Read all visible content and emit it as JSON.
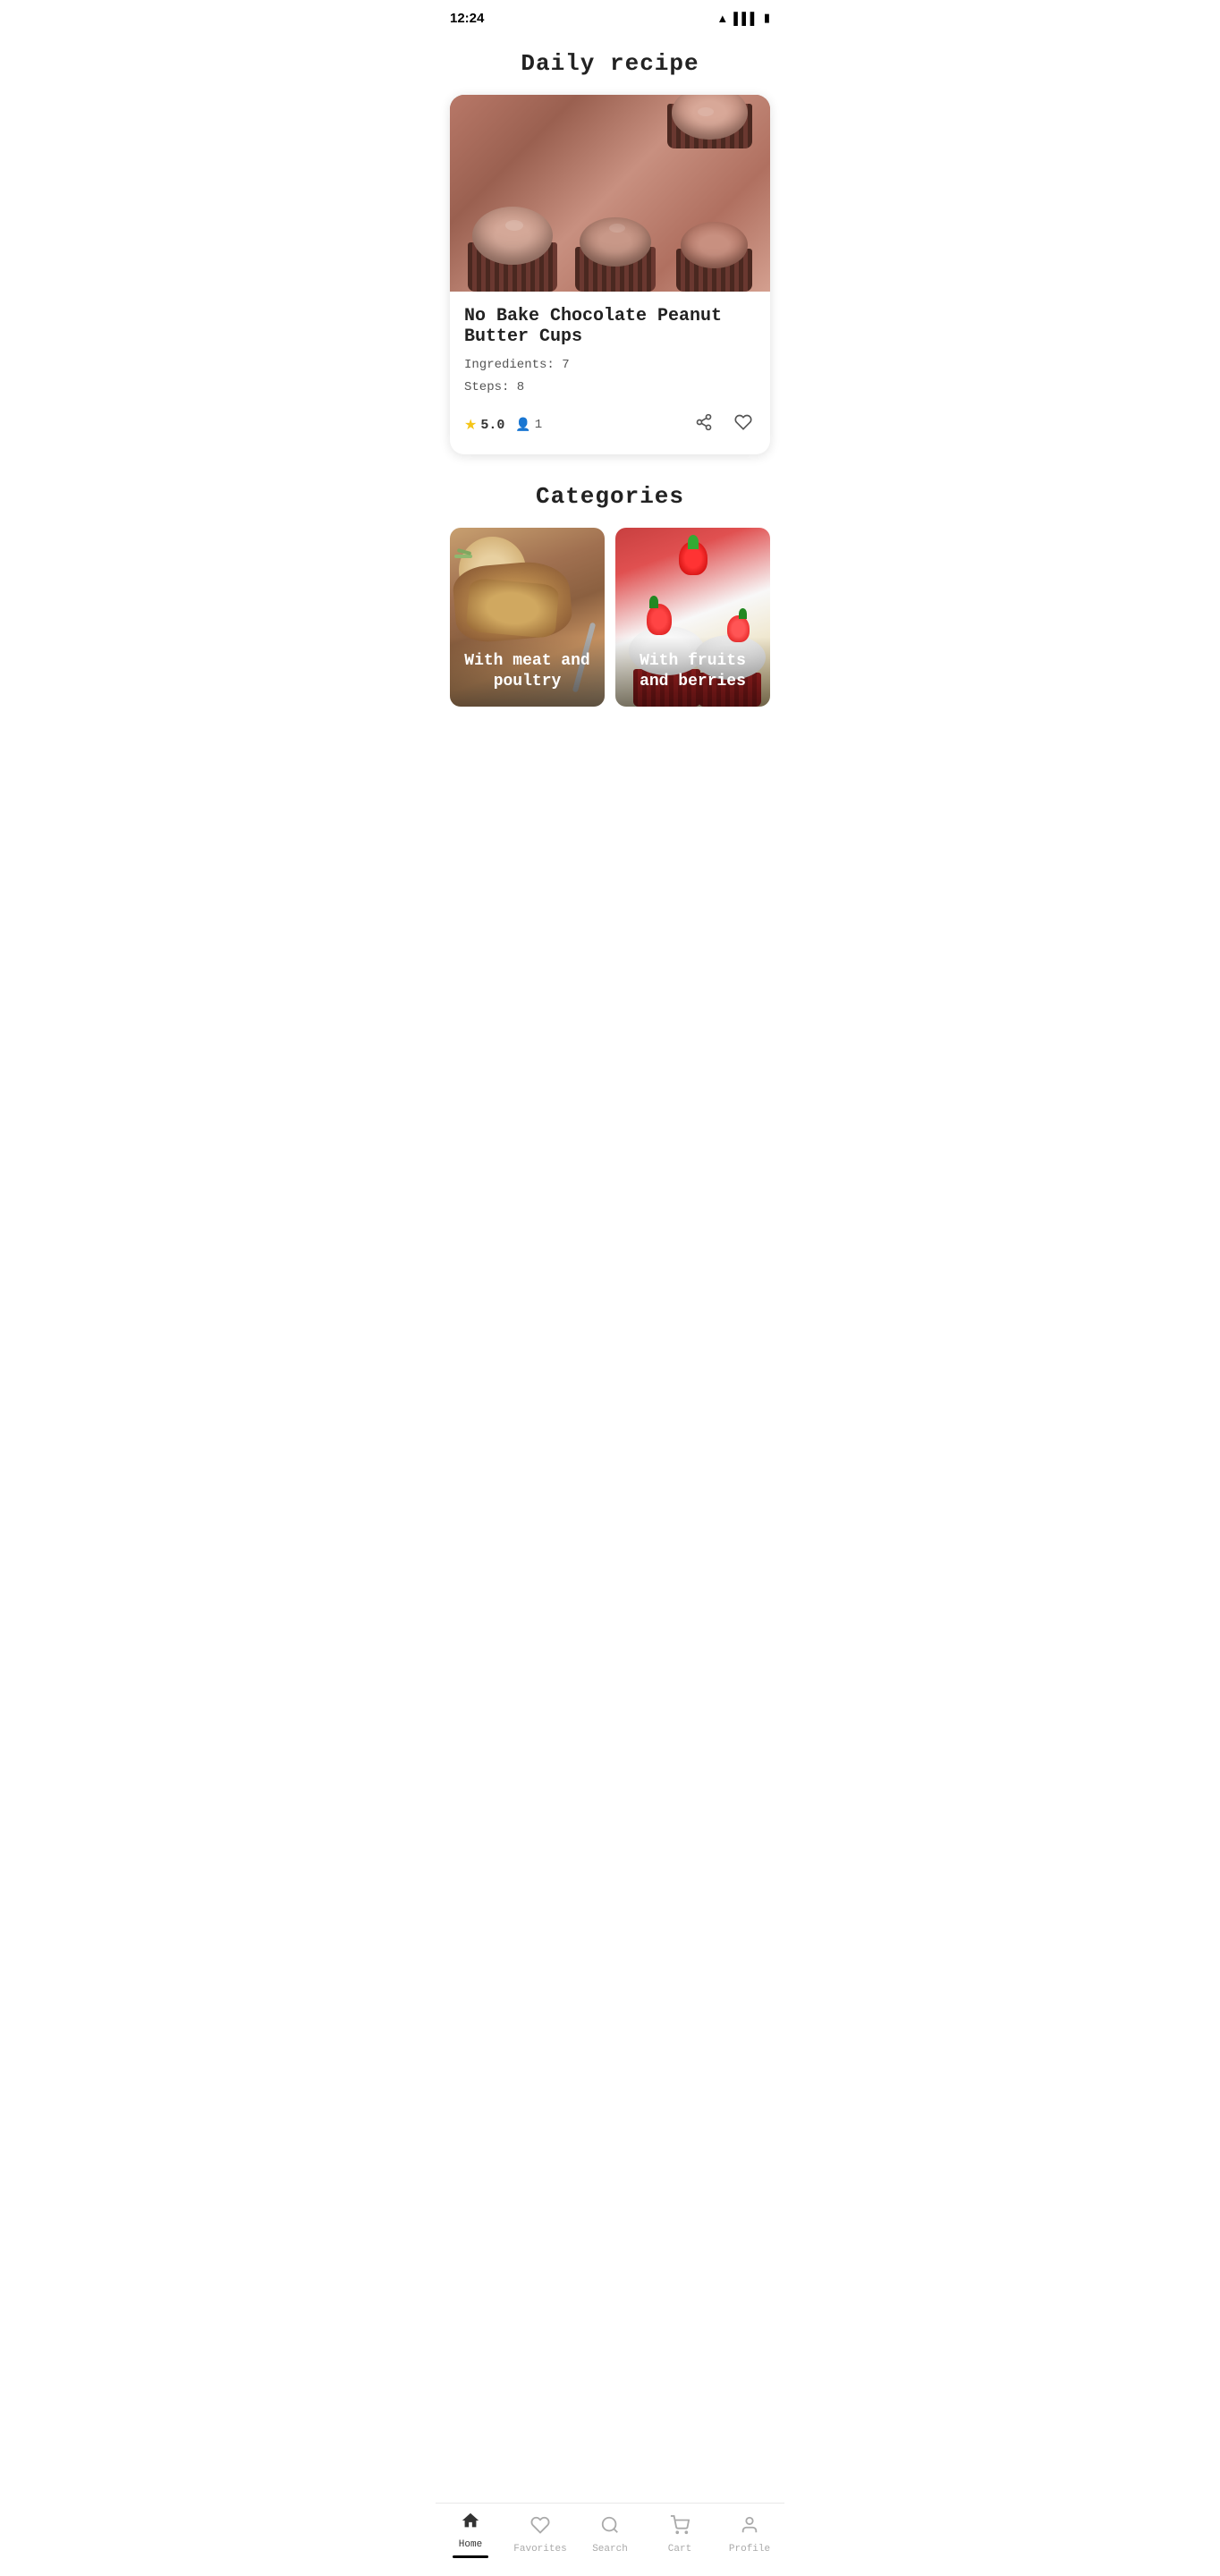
{
  "statusBar": {
    "time": "12:24",
    "icons": [
      "wifi",
      "signal",
      "battery"
    ]
  },
  "header": {
    "dailyRecipeTitle": "Daily recipe"
  },
  "recipe": {
    "name": "No Bake Chocolate Peanut Butter Cups",
    "ingredients": "Ingredients: 7",
    "steps": "Steps: 8",
    "rating": "5.0",
    "reviews": "1",
    "shareLabel": "share",
    "favoriteLabel": "favorite"
  },
  "categories": {
    "title": "Categories",
    "items": [
      {
        "name": "With meat and poultry",
        "type": "meat"
      },
      {
        "name": "With fruits and berries",
        "type": "fruits"
      }
    ]
  },
  "bottomNav": {
    "items": [
      {
        "id": "home",
        "label": "Home",
        "active": true
      },
      {
        "id": "favorites",
        "label": "Favorites",
        "active": false
      },
      {
        "id": "search",
        "label": "Search",
        "active": false
      },
      {
        "id": "cart",
        "label": "Cart",
        "active": false
      },
      {
        "id": "profile",
        "label": "Profile",
        "active": false
      }
    ]
  }
}
